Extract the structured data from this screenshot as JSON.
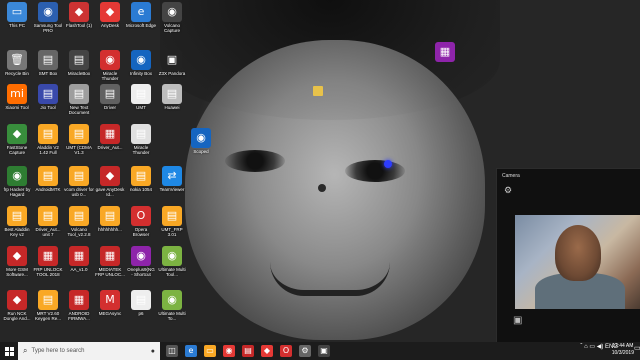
{
  "desktop": {
    "icons": [
      {
        "label": "This PC",
        "glyph": "▭",
        "color": "#3b88d8"
      },
      {
        "label": "Samsung Tool PRO",
        "glyph": "◉",
        "color": "#2b5fb0"
      },
      {
        "label": "FlashTool (1)",
        "glyph": "◆",
        "color": "#c33"
      },
      {
        "label": "AnyDesk",
        "glyph": "◆",
        "color": "#e53935"
      },
      {
        "label": "Microsoft Edge",
        "glyph": "e",
        "color": "#2b7bd3"
      },
      {
        "label": "Volcano Capture",
        "glyph": "◉",
        "color": "#444"
      },
      {
        "label": "Recycle Bin",
        "glyph": "🗑",
        "color": "#777"
      },
      {
        "label": "SMT Box",
        "glyph": "▤",
        "color": "#666"
      },
      {
        "label": "MiracleBox",
        "glyph": "▤",
        "color": "#444"
      },
      {
        "label": "Miracle Thunder",
        "glyph": "◉",
        "color": "#d32f2f"
      },
      {
        "label": "Infinity Box",
        "glyph": "◉",
        "color": "#1565c0"
      },
      {
        "label": "Z3X Pandora",
        "glyph": "▣",
        "color": "#222"
      },
      {
        "label": "Xiaomi Tool",
        "glyph": "mi",
        "color": "#ff6d00"
      },
      {
        "label": "Jio Tool",
        "glyph": "▤",
        "color": "#3949ab"
      },
      {
        "label": "New Text Document",
        "glyph": "▤",
        "color": "#9e9e9e"
      },
      {
        "label": "Driver",
        "glyph": "▤",
        "color": "#616161"
      },
      {
        "label": "UMT",
        "glyph": "▤",
        "color": "#eee"
      },
      {
        "label": "Huawei",
        "glyph": "▤",
        "color": "#bdbdbd"
      },
      {
        "label": "FastStone Capture",
        "glyph": "◆",
        "color": "#388e3c"
      },
      {
        "label": "Aladdin V2 1.42 Full",
        "glyph": "▤",
        "color": "#f9a825"
      },
      {
        "label": "UMT (CDMA V1.3",
        "glyph": "▤",
        "color": "#f9a825"
      },
      {
        "label": "Driver_Aut...",
        "glyph": "▦",
        "color": "#c62828"
      },
      {
        "label": "Miracle Thunder",
        "glyph": "▤",
        "color": "#e0e0e0"
      },
      {
        "label": "frp Hacker by Hagard",
        "glyph": "◉",
        "color": "#2e7d32"
      },
      {
        "label": "AndroidMTK",
        "glyph": "▤",
        "color": "#f9a825"
      },
      {
        "label": "vcom driver for usb 0...",
        "glyph": "▤",
        "color": "#f9a825"
      },
      {
        "label": "gave AnyDesk Id...",
        "glyph": "◆",
        "color": "#c62828"
      },
      {
        "label": "nokia 1054",
        "glyph": "▤",
        "color": "#f9a825"
      },
      {
        "label": "TeamViewer",
        "glyph": "⇄",
        "color": "#1e88e5"
      },
      {
        "label": "Best Aladdin Key v2",
        "glyph": "▤",
        "color": "#f9a825"
      },
      {
        "label": "Driver_Aut... unit 7",
        "glyph": "▤",
        "color": "#f9a825"
      },
      {
        "label": "Volcano Tool_v2.2.8",
        "glyph": "▤",
        "color": "#f9a825"
      },
      {
        "label": "hhhhhhhh...",
        "glyph": "▤",
        "color": "#f9a825"
      },
      {
        "label": "Opera Browser",
        "glyph": "O",
        "color": "#d32f2f"
      },
      {
        "label": "UMT_FRP 3.01",
        "glyph": "▤",
        "color": "#f9a825"
      },
      {
        "label": "More GSM Software...",
        "glyph": "◆",
        "color": "#c62828"
      },
      {
        "label": "FRP UNLOCK TOOL 2018",
        "glyph": "▦",
        "color": "#c62828"
      },
      {
        "label": "AA_v1.0",
        "glyph": "▦",
        "color": "#c62828"
      },
      {
        "label": "MEDIATEK FRP UNLOC...",
        "glyph": "▦",
        "color": "#c62828"
      },
      {
        "label": "Oneplus9(NG - Shortcut",
        "glyph": "◉",
        "color": "#8e24aa"
      },
      {
        "label": "Ultimate Multi Tool...",
        "glyph": "◉",
        "color": "#7cb342"
      },
      {
        "label": "Run NCK Dongle And...",
        "glyph": "◆",
        "color": "#c62828"
      },
      {
        "label": "MRT V2.60 Keygen Re...",
        "glyph": "▤",
        "color": "#f9a825"
      },
      {
        "label": "ANDROID FIRMWA...",
        "glyph": "▦",
        "color": "#c62828"
      },
      {
        "label": "MEGAsync",
        "glyph": "M",
        "color": "#d32f2f"
      },
      {
        "label": "p6",
        "glyph": "▤",
        "color": "#eee"
      },
      {
        "label": "Ultimate Multi To...",
        "glyph": "◉",
        "color": "#7cb342"
      }
    ],
    "extra_icons": [
      {
        "label": "",
        "glyph": "▦",
        "color": "#8e24aa"
      },
      {
        "label": "Scoped",
        "glyph": "◉",
        "color": "#1565c0"
      }
    ]
  },
  "camera": {
    "title": "Camera",
    "gear": "⚙",
    "capture_icon": "▣"
  },
  "taskbar": {
    "search_placeholder": "Type here to search",
    "time": "12:44 AM",
    "date": "10/3/2019",
    "tray": "ˆ ⌂ ▭ ◀) ENG",
    "apps": [
      {
        "glyph": "◫",
        "color": "#555"
      },
      {
        "glyph": "e",
        "color": "#2b7bd3"
      },
      {
        "glyph": "▭",
        "color": "#f9a825"
      },
      {
        "glyph": "◉",
        "color": "#e53935"
      },
      {
        "glyph": "▤",
        "color": "#c62828"
      },
      {
        "glyph": "◆",
        "color": "#e53935"
      },
      {
        "glyph": "O",
        "color": "#d32f2f"
      },
      {
        "glyph": "⚙",
        "color": "#666"
      },
      {
        "glyph": "▣",
        "color": "#444"
      }
    ]
  }
}
